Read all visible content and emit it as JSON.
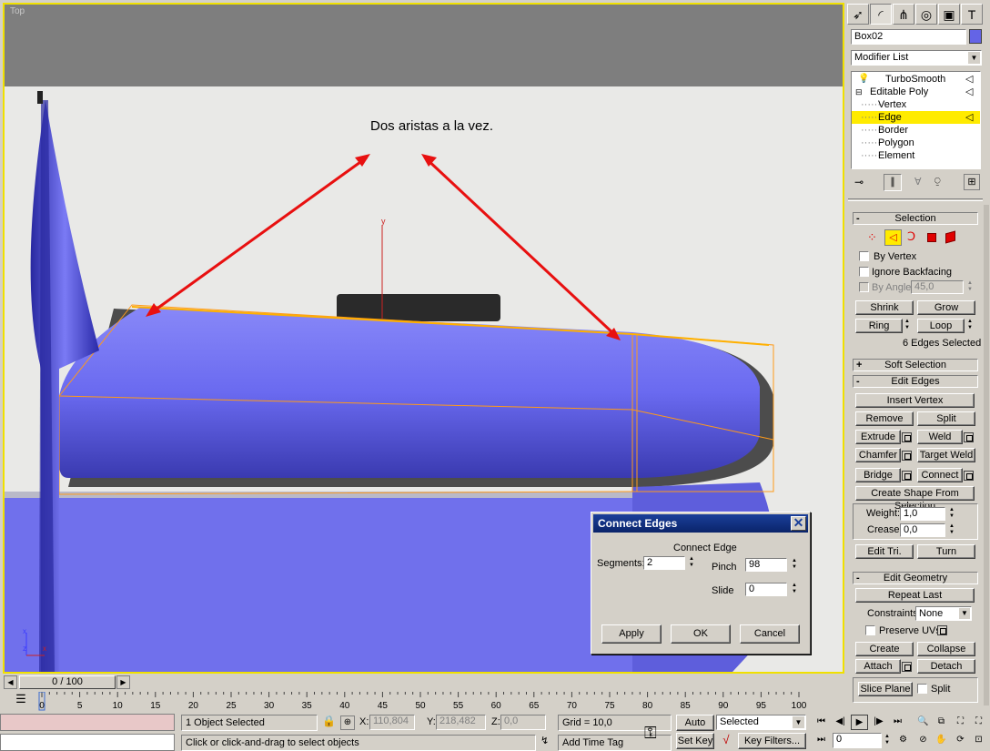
{
  "viewport": {
    "label": "Top",
    "annotation": "Dos aristas a la vez.",
    "axis_y": "y",
    "axis_labels": [
      "x",
      "z",
      "x"
    ]
  },
  "dialog": {
    "title": "Connect Edges",
    "group_label": "Connect Edge",
    "segments_label": "Segments:",
    "segments_value": "2",
    "pinch_label": "Pinch",
    "pinch_value": "98",
    "slide_label": "Slide",
    "slide_value": "0",
    "apply_label": "Apply",
    "ok_label": "OK",
    "cancel_label": "Cancel"
  },
  "command_panel": {
    "tabs": [
      "create-icon",
      "modify-icon",
      "hierarchy-icon",
      "motion-icon",
      "display-icon",
      "utilities-icon"
    ],
    "object_name": "Box02",
    "object_color": "#6464e6",
    "modifier_list": "Modifier List",
    "stack": [
      {
        "label": "TurboSmooth",
        "level": 0
      },
      {
        "label": "Editable Poly",
        "level": 0
      },
      {
        "label": "Vertex",
        "level": 1
      },
      {
        "label": "Edge",
        "level": 1,
        "selected": true
      },
      {
        "label": "Border",
        "level": 1
      },
      {
        "label": "Polygon",
        "level": 1
      },
      {
        "label": "Element",
        "level": 1
      }
    ],
    "selection": {
      "header": "Selection",
      "by_vertex": "By Vertex",
      "ignore_backfacing": "Ignore Backfacing",
      "by_angle": "By Angle:",
      "by_angle_value": "45,0",
      "shrink": "Shrink",
      "grow": "Grow",
      "ring": "Ring",
      "loop": "Loop",
      "status": "6 Edges Selected"
    },
    "soft_selection": "Soft Selection",
    "edit_edges": {
      "header": "Edit Edges",
      "insert_vertex": "Insert Vertex",
      "remove": "Remove",
      "split": "Split",
      "extrude": "Extrude",
      "weld": "Weld",
      "chamfer": "Chamfer",
      "target_weld": "Target Weld",
      "bridge": "Bridge",
      "connect": "Connect",
      "create_shape": "Create Shape From Selection",
      "weight_label": "Weight:",
      "weight_value": "1,0",
      "crease_label": "Crease:",
      "crease_value": "0,0",
      "edit_tri": "Edit Tri.",
      "turn": "Turn"
    },
    "edit_geometry": {
      "header": "Edit Geometry",
      "repeat_last": "Repeat Last",
      "constraints_label": "Constraints:",
      "constraints_value": "None",
      "preserve_uvs": "Preserve UVs",
      "create": "Create",
      "collapse": "Collapse",
      "attach": "Attach",
      "detach": "Detach",
      "slice_plane": "Slice Plane",
      "split": "Split"
    }
  },
  "timeline": {
    "frame": "0 / 100",
    "ticks": [
      "0",
      "5",
      "10",
      "15",
      "20",
      "25",
      "30",
      "35",
      "40",
      "45",
      "50",
      "55",
      "60",
      "65",
      "70",
      "75",
      "80",
      "85",
      "90",
      "95",
      "100"
    ]
  },
  "status": {
    "selected": "1 Object Selected",
    "prompt": "Click or click-and-drag to select objects",
    "x_label": "X:",
    "x_value": "110,804",
    "y_label": "Y:",
    "y_value": "218,482",
    "z_label": "Z:",
    "z_value": "0,0",
    "grid": "Grid = 10,0",
    "add_time_tag": "Add Time Tag",
    "auto_key": "Auto Key",
    "set_key": "Set Key",
    "selected_dropdown": "Selected",
    "key_filters": "Key Filters...",
    "current_frame": "0"
  }
}
